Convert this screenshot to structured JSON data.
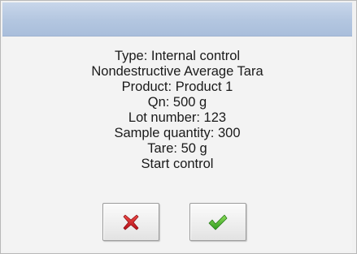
{
  "dialog": {
    "lines": [
      "Type: Internal control",
      "Nondestructive Average Tara",
      "Product: Product 1",
      "Qn: 500 g",
      "Lot number: 123",
      "Sample quantity: 300",
      "Tare: 50 g",
      "Start control"
    ],
    "cancel_icon": "red-x-icon",
    "confirm_icon": "green-checkmark-icon"
  },
  "colors": {
    "title_bar": "#b3c6e0",
    "cancel": "#d6222a",
    "confirm": "#3fae2a"
  }
}
